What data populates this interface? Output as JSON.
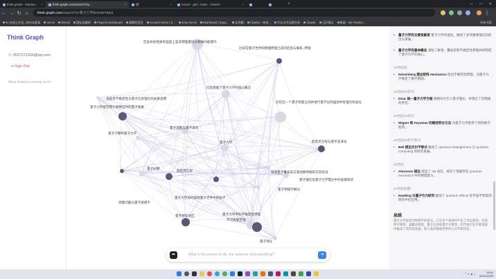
{
  "browser": {
    "tabs": [
      {
        "label": "think-graph - Deployments",
        "active": false
      },
      {
        "label": "think-graph.com/search?q=",
        "active": true
      },
      {
        "label": "她",
        "active": false
      },
      {
        "label": "house - gen- notes - Search",
        "active": false
      },
      {
        "label": "",
        "active": false
      },
      {
        "label": "",
        "active": false
      }
    ],
    "url_host": "think-graph.com",
    "url_path": "/search?q=量子力学&mode=dark",
    "bookmarks": [
      "IN-在线工作台_GitHub登录",
      "Vercel",
      "GitHub",
      "国际化翻译",
      "Projects Dashboard",
      "请教的项目",
      "Account Home | E...",
      "ai-by-Vercel",
      "Dashboard | Supa...",
      "北京翻",
      "Chatbot - 哈哈...",
      "大众点评品牌分析",
      "Claude",
      "日历笔记",
      "数据 - doc Runtim..."
    ],
    "bookmarks_folder": "所有书签"
  },
  "sidebar": {
    "brand": "Think Graph",
    "user_email": "3537271310@qq.com",
    "signout_label": "Sign Out",
    "more_text": "More features coming soon!"
  },
  "graph": {
    "nodes": [
      {
        "id": "n1",
        "label": "巴兹体验性质的强度上是非物理量吗与物质的能量吗"
      },
      {
        "id": "n2",
        "label": "比较在量子世界和物理原理之间的区别与联系, 原理"
      },
      {
        "id": "n3",
        "label": "量子力学"
      },
      {
        "id": "n4",
        "label": "比较基础下量子力学的核心概念"
      },
      {
        "id": "n5",
        "label": "比较在一个量子测量之间并进行量子化的描述并处理为标准化"
      },
      {
        "id": "n6",
        "label": "量子力学能否用于解释自然的量子现象"
      },
      {
        "id": "n7",
        "label": "量子测量与量子波动"
      },
      {
        "id": "n8",
        "label": "量子计算和量子力学"
      },
      {
        "id": "n9",
        "label": "海森堡不确定性与量子信息理论的关系说明"
      },
      {
        "id": "n10",
        "label": "薛定谔方程与量子态演化"
      },
      {
        "id": "n11",
        "label": "量子纠缠"
      },
      {
        "id": "n12",
        "label": "量子通信在量子力学理论中的发展现状"
      },
      {
        "id": "n13",
        "label": "观测量子叠加态与波函数坍缩的实验验证"
      },
      {
        "id": "n14",
        "label": "量子物理学概论"
      },
      {
        "id": "n15",
        "label": "量子力学如何描述量子世界中的粒子"
      },
      {
        "id": "n16",
        "label": "薛定谔方程"
      },
      {
        "id": "n17",
        "label": "测量问题与量子退相干"
      },
      {
        "id": "n18",
        "label": "量子隧穿效应"
      },
      {
        "id": "n19",
        "label": "不可克隆定理"
      },
      {
        "id": "n20",
        "label": "量子力学中的不确定性原理"
      },
      {
        "id": "n21",
        "label": "量子场论"
      }
    ]
  },
  "chat": {
    "placeholder": "What is the answer to life, the universe, and everything?"
  },
  "right_panel": {
    "items": [
      {
        "title": "量子力学的主要贡献者",
        "text": "量子力学的诞生，推动了多项重要理论的提出与发展。"
      },
      {
        "title": "量子力学的基本概念",
        "text": "波粒二象性、叠加态和不确定性原理共同构成了量子力学的核心。"
      },
      {
        "section": "20世纪初"
      },
      {
        "title": "Heisenberg 提出矩阵 mechanics",
        "text": "提出不确定性原理，为量子力学奠定了数学基础。"
      },
      {
        "section": "20世纪20年代"
      },
      {
        "title": "Dirac 统一量子力学方程",
        "text": "将相对论引入量子理论，并预言了反物质的存在。"
      },
      {
        "section": "20世纪40年代"
      },
      {
        "title": "Wigner 和 Feynman 的路径积分方法",
        "text": "为量子力学提供了新的数学框架。"
      },
      {
        "section": "20世纪60年代至今"
      },
      {
        "title": "Bell 提出贝尔不等式",
        "text": "推动了 quantum entanglement 与 quantum computing 的研究发展。"
      },
      {
        "section": "20世纪"
      },
      {
        "title": "Aharonov 提出",
        "text": "提出了 AB 效应，揭示了电磁势在 quantum mechanics 中的物理意义。"
      },
      {
        "section": "21世纪初期"
      },
      {
        "title": "Hawking 与量子引力研究",
        "text": "推动了 quantum effects 在宇宙学和黑洞研究中的应用。"
      }
    ],
    "summary_title": "总结",
    "summary_text": "量子力学是现代物理学的基石，它在多个领域中产生了深远影响，包括原子物理、凝聚态物理、量子信息和量子计算等，科学家们在不断探索中推动了其持续发展，使人类对微观世界的认识不断深化。"
  },
  "taskbar": {
    "time": "19:42",
    "date": "2024/10/29"
  }
}
